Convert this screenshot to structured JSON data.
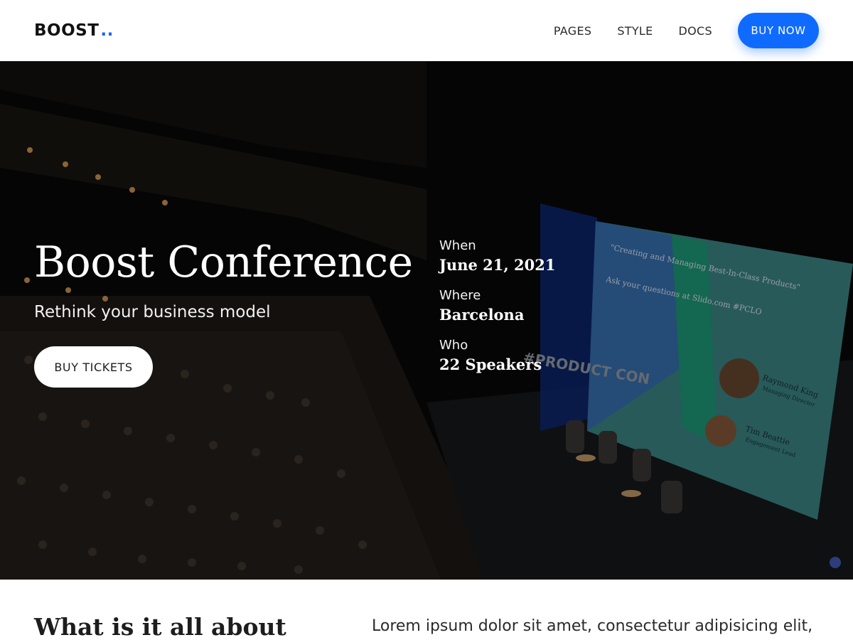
{
  "brand": {
    "name": "BOOST",
    "dots": "..",
    "dot_color": "#1466f5"
  },
  "nav": {
    "links": [
      "PAGES",
      "STYLE",
      "DOCS"
    ],
    "cta_label": "BUY NOW",
    "cta_color": "#0f6bff"
  },
  "hero": {
    "title": "Boost Conference",
    "subtitle": "Rethink your business model",
    "button_label": "BUY TICKETS",
    "info": [
      {
        "label": "When",
        "value": "June 21, 2021"
      },
      {
        "label": "Where",
        "value": "Barcelona"
      },
      {
        "label": "Who",
        "value": "22 Speakers"
      }
    ],
    "image": {
      "screen_text_left": "\"Creating and Managing Best-In-Class Products\"",
      "screen_text_left_2": "Ask your questions at Slido.com #PCLO",
      "stage_sign": "#PRODUCT CON",
      "speaker_1_name": "Raymond King",
      "speaker_1_role": "Managing Director",
      "speaker_2_name": "Tim Beattie",
      "speaker_2_role": "Engagement Lead"
    }
  },
  "about": {
    "title": "What is it all about",
    "text": "Lorem ipsum dolor sit amet, consectetur adipisicing elit,"
  }
}
